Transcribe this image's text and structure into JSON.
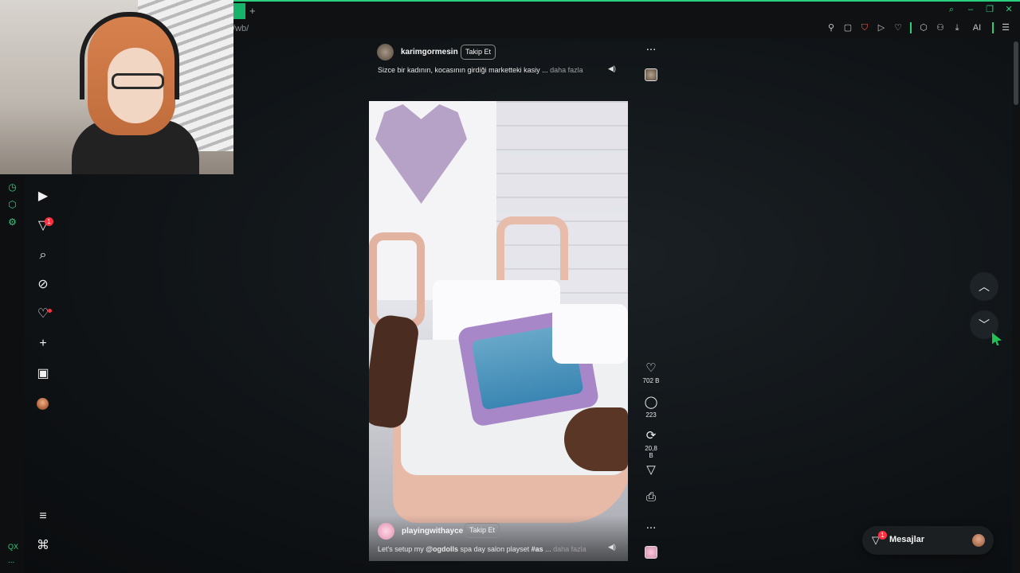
{
  "browser": {
    "url_fragment": "/wb/",
    "new_tab_label": "+",
    "toolbar_icons": [
      "pin-icon",
      "screenshot-icon",
      "shield-icon",
      "play-icon",
      "heart-icon",
      "extensions-icon",
      "profile-icon",
      "download-icon",
      "ai-icon",
      "menu-icon"
    ],
    "ai_label": "AI",
    "accent_color": "#2bd07f"
  },
  "leftnav": {
    "items": [
      "home-icon",
      "direct-icon",
      "search-icon",
      "explore-icon",
      "notifications-icon",
      "create-icon",
      "dashboard-icon",
      "profile-avatar"
    ],
    "direct_badge": "1",
    "more_icon": "hamburger-icon",
    "meta_icon": "meta-icon"
  },
  "rail": {
    "qx_label": "QX",
    "dots": "..."
  },
  "post_top": {
    "username": "karimgormesin",
    "follow_label": "Takip Et",
    "caption": "Sizce bir kadının, kocasının girdiği marketteki kasiy ...",
    "more": "daha fazla"
  },
  "post_main": {
    "username": "playingwithayce",
    "follow_label": "Takip Et",
    "caption_prefix": "Let's setup my ",
    "caption_mention": "@ogdolls",
    "caption_mid": " spa day salon playset ",
    "caption_tag": "#as",
    "caption_ellipsis": " ...",
    "more": "daha fazla"
  },
  "actions": {
    "top_more": "...",
    "likes": "702 B",
    "comments": "223",
    "reposts": "20,8 B",
    "more": "..."
  },
  "messages": {
    "label": "Mesajlar",
    "badge": "1"
  },
  "nav": {
    "up": "^",
    "down": "v"
  }
}
